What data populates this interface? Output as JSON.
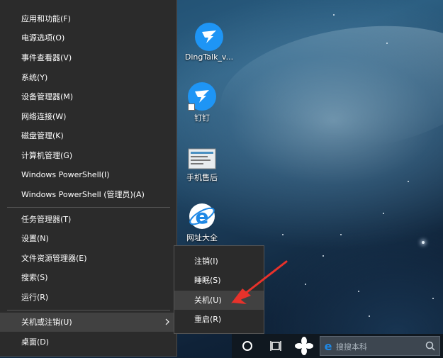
{
  "start_menu": {
    "items": [
      "应用和功能(F)",
      "电源选项(O)",
      "事件查看器(V)",
      "系统(Y)",
      "设备管理器(M)",
      "网络连接(W)",
      "磁盘管理(K)",
      "计算机管理(G)",
      "Windows PowerShell(I)",
      "Windows PowerShell (管理员)(A)",
      "任务管理器(T)",
      "设置(N)",
      "文件资源管理器(E)",
      "搜索(S)",
      "运行(R)",
      "关机或注销(U)",
      "桌面(D)"
    ]
  },
  "submenu": {
    "items": [
      "注销(I)",
      "睡眠(S)",
      "关机(U)",
      "重启(R)"
    ],
    "highlighted": "关机(U)"
  },
  "desktop": {
    "icons": [
      {
        "label": "DingTalk_v...",
        "icon": "dingtalk-icon"
      },
      {
        "label": "钉钉",
        "icon": "dingtalk-icon"
      },
      {
        "label": "手机售后",
        "icon": "document-thumbnail-icon"
      },
      {
        "label": "网址大全",
        "icon": "ie-icon"
      }
    ]
  },
  "taskbar": {
    "search_placeholder": "搜搜本科"
  },
  "colors": {
    "menu_bg": "#2b2b2b",
    "menu_highlight": "#414141",
    "arrow": "#e8322b",
    "dingtalk_blue": "#1e95f5",
    "ie_blue": "#1e88e5"
  }
}
